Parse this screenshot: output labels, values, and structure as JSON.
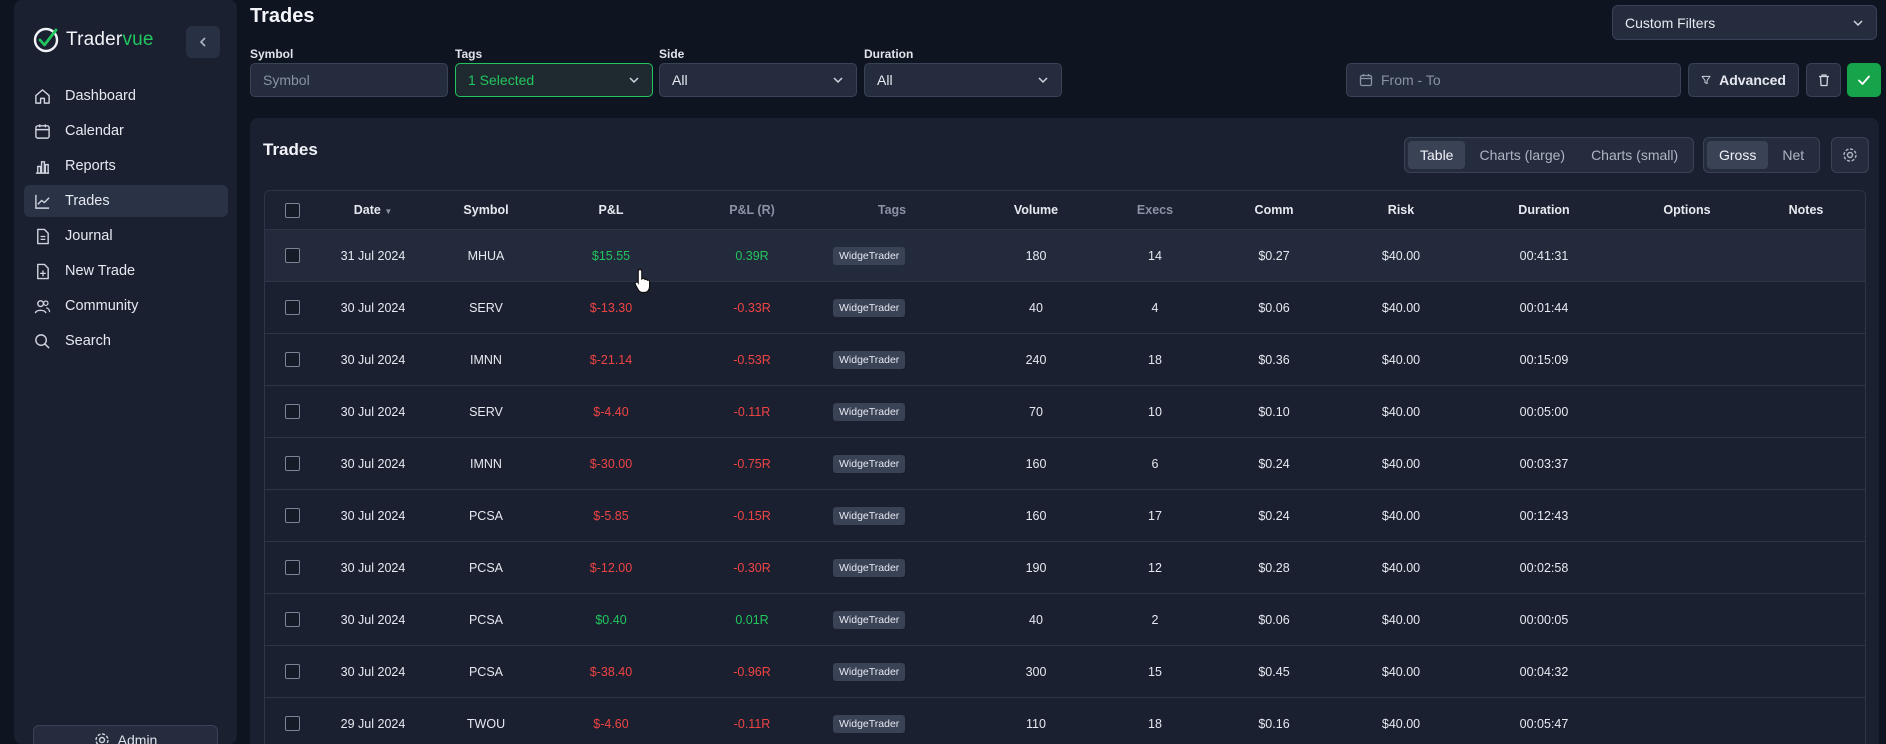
{
  "brand": {
    "name_main": "Trader",
    "name_accent": "vue"
  },
  "sidebar": {
    "items": [
      {
        "label": "Dashboard",
        "icon": "home-icon"
      },
      {
        "label": "Calendar",
        "icon": "calendar-icon"
      },
      {
        "label": "Reports",
        "icon": "bar-chart-icon"
      },
      {
        "label": "Trades",
        "icon": "trend-line-icon",
        "active": true
      },
      {
        "label": "Journal",
        "icon": "document-icon"
      },
      {
        "label": "New Trade",
        "icon": "file-plus-icon"
      },
      {
        "label": "Community",
        "icon": "users-icon"
      },
      {
        "label": "Search",
        "icon": "search-icon"
      }
    ],
    "admin_label": "Admin"
  },
  "header": {
    "title": "Trades",
    "custom_filters_label": "Custom Filters"
  },
  "filters": {
    "symbol": {
      "label": "Symbol",
      "placeholder": "Symbol"
    },
    "tags": {
      "label": "Tags",
      "value": "1 Selected"
    },
    "side": {
      "label": "Side",
      "value": "All"
    },
    "duration": {
      "label": "Duration",
      "value": "All"
    },
    "date_range_placeholder": "From - To",
    "advanced_label": "Advanced"
  },
  "card": {
    "title": "Trades",
    "view_tabs": [
      "Table",
      "Charts (large)",
      "Charts (small)"
    ],
    "active_view": "Table",
    "pnl_tabs": [
      "Gross",
      "Net"
    ],
    "active_pnl": "Gross"
  },
  "table": {
    "columns": [
      "Date",
      "Symbol",
      "P&L",
      "P&L (R)",
      "Tags",
      "Volume",
      "Execs",
      "Comm",
      "Risk",
      "Duration",
      "Options",
      "Notes"
    ],
    "rows": [
      {
        "date": "31 Jul 2024",
        "symbol": "MHUA",
        "pnl": "$15.55",
        "pnl_r": "0.39R",
        "tag": "WidgeTrader",
        "volume": "180",
        "execs": "14",
        "comm": "$0.27",
        "risk": "$40.00",
        "duration": "00:41:31",
        "positive": true
      },
      {
        "date": "30 Jul 2024",
        "symbol": "SERV",
        "pnl": "$-13.30",
        "pnl_r": "-0.33R",
        "tag": "WidgeTrader",
        "volume": "40",
        "execs": "4",
        "comm": "$0.06",
        "risk": "$40.00",
        "duration": "00:01:44",
        "positive": false
      },
      {
        "date": "30 Jul 2024",
        "symbol": "IMNN",
        "pnl": "$-21.14",
        "pnl_r": "-0.53R",
        "tag": "WidgeTrader",
        "volume": "240",
        "execs": "18",
        "comm": "$0.36",
        "risk": "$40.00",
        "duration": "00:15:09",
        "positive": false
      },
      {
        "date": "30 Jul 2024",
        "symbol": "SERV",
        "pnl": "$-4.40",
        "pnl_r": "-0.11R",
        "tag": "WidgeTrader",
        "volume": "70",
        "execs": "10",
        "comm": "$0.10",
        "risk": "$40.00",
        "duration": "00:05:00",
        "positive": false
      },
      {
        "date": "30 Jul 2024",
        "symbol": "IMNN",
        "pnl": "$-30.00",
        "pnl_r": "-0.75R",
        "tag": "WidgeTrader",
        "volume": "160",
        "execs": "6",
        "comm": "$0.24",
        "risk": "$40.00",
        "duration": "00:03:37",
        "positive": false
      },
      {
        "date": "30 Jul 2024",
        "symbol": "PCSA",
        "pnl": "$-5.85",
        "pnl_r": "-0.15R",
        "tag": "WidgeTrader",
        "volume": "160",
        "execs": "17",
        "comm": "$0.24",
        "risk": "$40.00",
        "duration": "00:12:43",
        "positive": false
      },
      {
        "date": "30 Jul 2024",
        "symbol": "PCSA",
        "pnl": "$-12.00",
        "pnl_r": "-0.30R",
        "tag": "WidgeTrader",
        "volume": "190",
        "execs": "12",
        "comm": "$0.28",
        "risk": "$40.00",
        "duration": "00:02:58",
        "positive": false
      },
      {
        "date": "30 Jul 2024",
        "symbol": "PCSA",
        "pnl": "$0.40",
        "pnl_r": "0.01R",
        "tag": "WidgeTrader",
        "volume": "40",
        "execs": "2",
        "comm": "$0.06",
        "risk": "$40.00",
        "duration": "00:00:05",
        "positive": true
      },
      {
        "date": "30 Jul 2024",
        "symbol": "PCSA",
        "pnl": "$-38.40",
        "pnl_r": "-0.96R",
        "tag": "WidgeTrader",
        "volume": "300",
        "execs": "15",
        "comm": "$0.45",
        "risk": "$40.00",
        "duration": "00:04:32",
        "positive": false
      },
      {
        "date": "29 Jul 2024",
        "symbol": "TWOU",
        "pnl": "$-4.60",
        "pnl_r": "-0.11R",
        "tag": "WidgeTrader",
        "volume": "110",
        "execs": "18",
        "comm": "$0.16",
        "risk": "$40.00",
        "duration": "00:05:47",
        "positive": false
      }
    ]
  },
  "colors": {
    "accent": "#22c55e",
    "negative": "#ef4444",
    "background": "#0f1421",
    "panel": "#1a2030"
  }
}
